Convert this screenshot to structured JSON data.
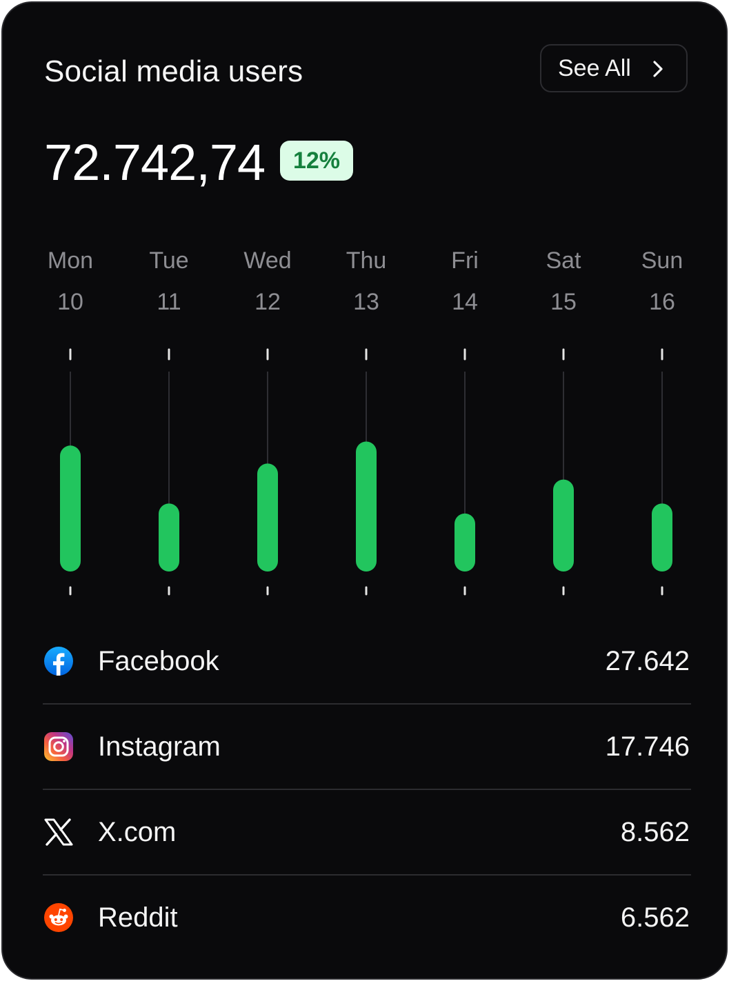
{
  "card": {
    "title": "Social media users",
    "see_all_label": "See All",
    "total": "72.742,74",
    "change_badge": "12%"
  },
  "colors": {
    "background": "#0a0a0c",
    "bar": "#22c55e",
    "badge_bg": "#dcfce7",
    "badge_text": "#15803d",
    "divider": "#2c2c30"
  },
  "chart_data": {
    "type": "bar",
    "categories": [
      "Mon 10",
      "Tue 11",
      "Wed 12",
      "Thu 13",
      "Fri 14",
      "Sat 15",
      "Sun 16"
    ],
    "days": [
      {
        "day": "Mon",
        "date": "10",
        "value": 0.63
      },
      {
        "day": "Tue",
        "date": "11",
        "value": 0.34
      },
      {
        "day": "Wed",
        "date": "12",
        "value": 0.54
      },
      {
        "day": "Thu",
        "date": "13",
        "value": 0.65
      },
      {
        "day": "Fri",
        "date": "14",
        "value": 0.29
      },
      {
        "day": "Sat",
        "date": "15",
        "value": 0.46
      },
      {
        "day": "Sun",
        "date": "16",
        "value": 0.34
      }
    ],
    "ylim": [
      0,
      1
    ],
    "title": "",
    "xlabel": "",
    "ylabel": ""
  },
  "platforms": [
    {
      "name": "Facebook",
      "value": "27.642",
      "icon": "facebook-icon"
    },
    {
      "name": "Instagram",
      "value": "17.746",
      "icon": "instagram-icon"
    },
    {
      "name": "X.com",
      "value": "8.562",
      "icon": "x-icon"
    },
    {
      "name": "Reddit",
      "value": "6.562",
      "icon": "reddit-icon"
    }
  ]
}
